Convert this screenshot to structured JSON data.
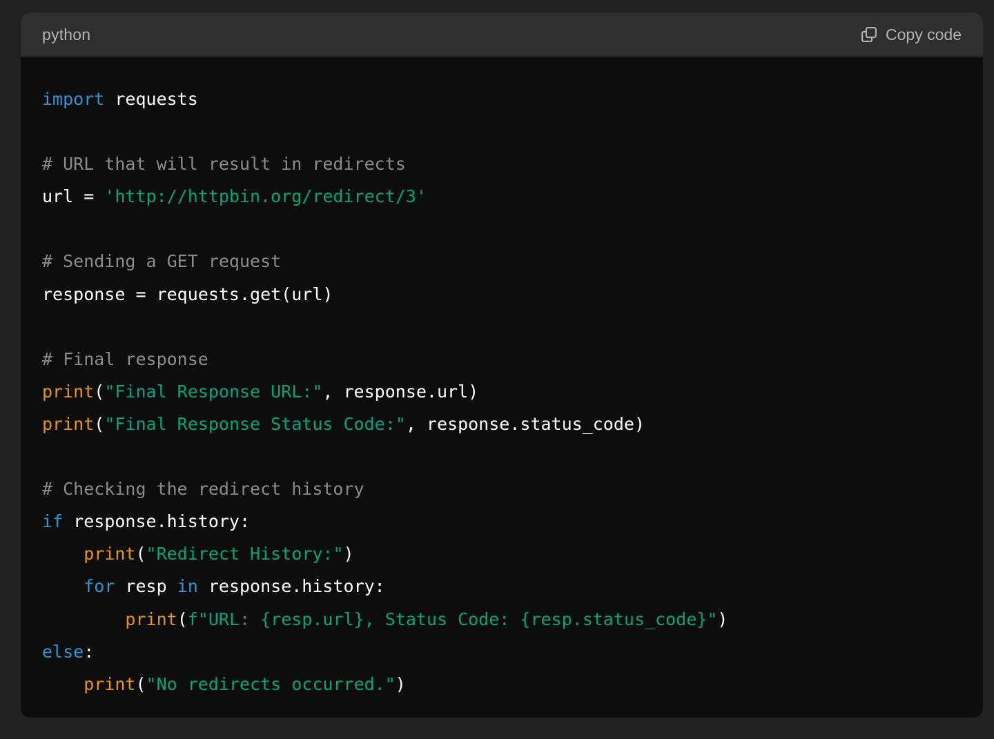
{
  "header": {
    "language": "python",
    "copy_label": "Copy code",
    "copy_icon": "copy-icon"
  },
  "colors": {
    "page_background": "#212121",
    "header_background": "#2f2f2f",
    "code_background": "#0d0d0d",
    "keyword": "#2e95d3",
    "comment": "#8b8b8b",
    "string": "#00a67d",
    "builtin_function": "#e9950c",
    "plain_text": "#ffffff"
  },
  "code": {
    "lines": [
      {
        "kw": "import",
        "rest": " requests"
      },
      {},
      {
        "comment": "# URL that will result in redirects"
      },
      {
        "a": "url = ",
        "str": "'http://httpbin.org/redirect/3'"
      },
      {},
      {
        "comment": "# Sending a GET request"
      },
      {
        "text": "response = requests.get(url)"
      },
      {},
      {
        "comment": "# Final response"
      },
      {
        "fn": "print",
        "open": "(",
        "str": "\"Final Response URL:\"",
        "rest": ", response.url)"
      },
      {
        "fn": "print",
        "open": "(",
        "str": "\"Final Response Status Code:\"",
        "rest": ", response.status_code)"
      },
      {},
      {
        "comment": "# Checking the redirect history"
      },
      {
        "kw": "if",
        "rest": " response.history:"
      },
      {
        "indent": "    ",
        "fn": "print",
        "open": "(",
        "str": "\"Redirect History:\"",
        "rest": ")"
      },
      {
        "indent": "    ",
        "kw": "for",
        "mid": " resp ",
        "kw2": "in",
        "rest": " response.history:"
      },
      {
        "indent": "        ",
        "fn": "print",
        "open": "(",
        "str": "f\"URL: {resp.url}, Status Code: {resp.status_code}\"",
        "rest": ")"
      },
      {
        "kw": "else",
        "rest": ":"
      },
      {
        "indent": "    ",
        "fn": "print",
        "open": "(",
        "str": "\"No redirects occurred.\"",
        "rest": ")"
      }
    ]
  }
}
